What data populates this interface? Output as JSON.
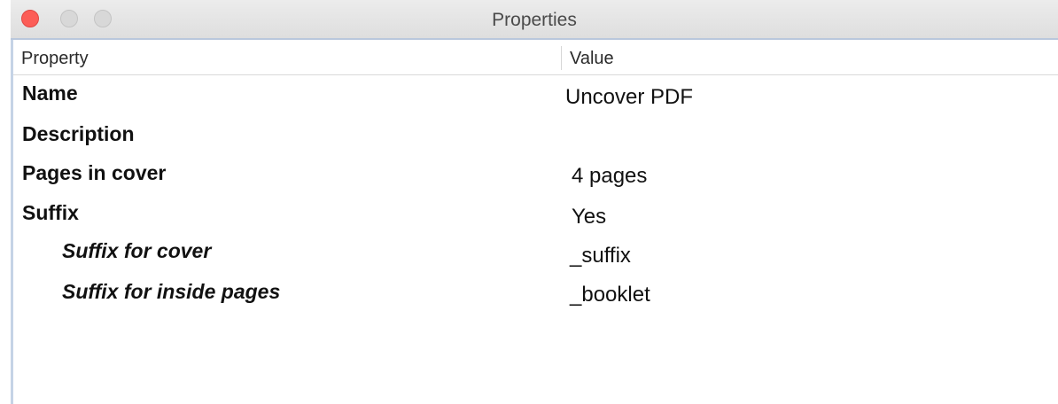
{
  "window": {
    "title": "Properties",
    "close_color": "#fc5d57"
  },
  "table": {
    "columns": {
      "property": "Property",
      "value": "Value"
    },
    "rows": [
      {
        "name": "Name",
        "value": "Uncover PDF",
        "level": 0
      },
      {
        "name": "Description",
        "value": "",
        "level": 0
      },
      {
        "name": "Pages in cover",
        "value": "4 pages",
        "level": 0
      },
      {
        "name": "Suffix",
        "value": "Yes",
        "level": 0
      },
      {
        "name": "Suffix for cover",
        "value": "_suffix",
        "level": 1
      },
      {
        "name": "Suffix for inside pages",
        "value": "_booklet",
        "level": 1
      }
    ]
  }
}
